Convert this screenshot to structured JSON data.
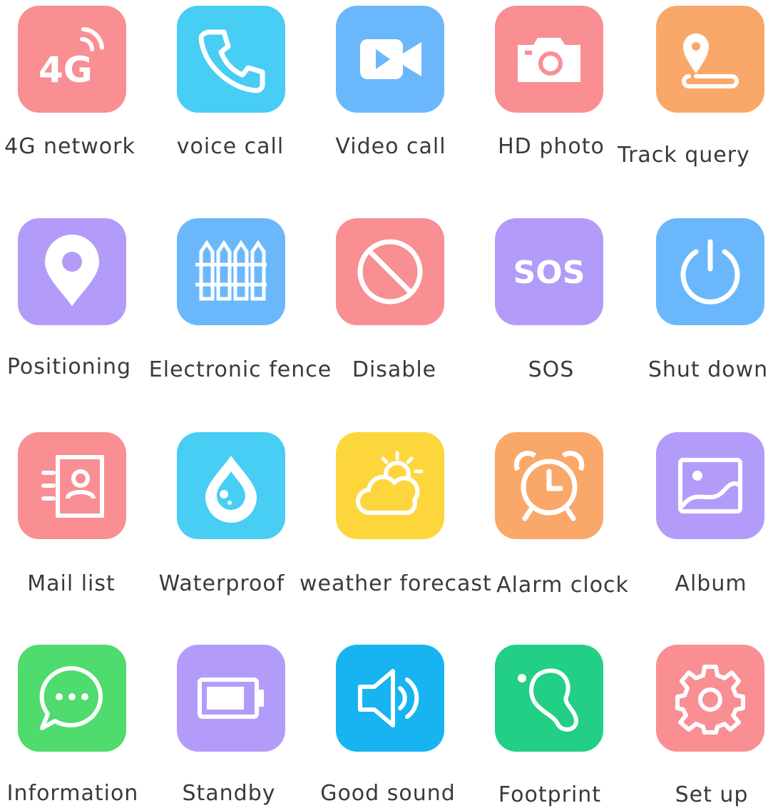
{
  "features": [
    {
      "label": "4G network",
      "icon": "4g-network-icon",
      "color": "#f98e93",
      "icon_text": "4G"
    },
    {
      "label": "voice call",
      "icon": "phone-icon",
      "color": "#48cdf4"
    },
    {
      "label": "Video call",
      "icon": "video-camera-icon",
      "color": "#6ab8fb"
    },
    {
      "label": "HD photo",
      "icon": "camera-icon",
      "color": "#f98e93"
    },
    {
      "label": "Track query",
      "icon": "track-pin-icon",
      "color": "#f9a86a"
    },
    {
      "label": "Positioning",
      "icon": "location-pin-icon",
      "color": "#b39cf9"
    },
    {
      "label": "Electronic fence",
      "icon": "fence-icon",
      "color": "#6ab8fb"
    },
    {
      "label": "Disable",
      "icon": "no-entry-icon",
      "color": "#f98e93"
    },
    {
      "label": "SOS",
      "icon": "sos-icon",
      "color": "#b39cf9",
      "icon_text": "SOS"
    },
    {
      "label": "Shut down",
      "icon": "power-icon",
      "color": "#6ab8fb"
    },
    {
      "label": "Mail list",
      "icon": "contact-book-icon",
      "color": "#f98e93"
    },
    {
      "label": "Waterproof",
      "icon": "water-drop-icon",
      "color": "#48cdf4"
    },
    {
      "label": "weather forecast",
      "icon": "weather-sun-cloud-icon",
      "color": "#fdd63c"
    },
    {
      "label": "Alarm clock",
      "icon": "alarm-clock-icon",
      "color": "#f9a86a"
    },
    {
      "label": "Album",
      "icon": "picture-icon",
      "color": "#b39cf9"
    },
    {
      "label": "Information",
      "icon": "chat-bubble-icon",
      "color": "#4fdb6e"
    },
    {
      "label": "Standby",
      "icon": "battery-icon",
      "color": "#b39cf9"
    },
    {
      "label": "Good sound",
      "icon": "speaker-icon",
      "color": "#17b4f1"
    },
    {
      "label": "Footprint",
      "icon": "footprint-icon",
      "color": "#22cf85"
    },
    {
      "label": "Set up",
      "icon": "gear-icon",
      "color": "#f98e93"
    }
  ]
}
